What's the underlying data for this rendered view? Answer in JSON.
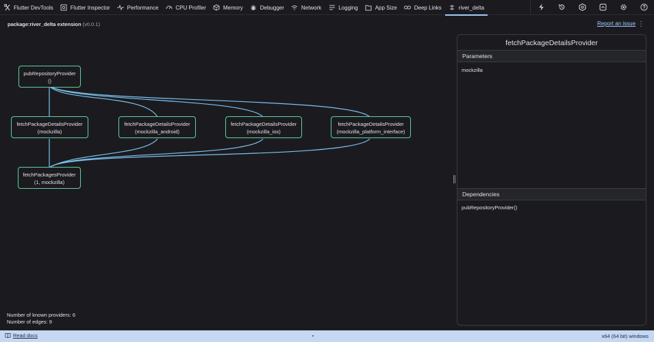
{
  "tabs": [
    {
      "label": "Flutter DevTools",
      "icon": "flutter-devtools-icon"
    },
    {
      "label": "Flutter Inspector",
      "icon": "inspector-icon"
    },
    {
      "label": "Performance",
      "icon": "performance-icon"
    },
    {
      "label": "CPU Profiler",
      "icon": "cpu-profiler-icon"
    },
    {
      "label": "Memory",
      "icon": "memory-icon"
    },
    {
      "label": "Debugger",
      "icon": "debugger-icon"
    },
    {
      "label": "Network",
      "icon": "network-icon"
    },
    {
      "label": "Logging",
      "icon": "logging-icon"
    },
    {
      "label": "App Size",
      "icon": "app-size-icon"
    },
    {
      "label": "Deep Links",
      "icon": "deep-links-icon"
    },
    {
      "label": "river_delta",
      "icon": "extension-icon",
      "active": true
    }
  ],
  "actions": [
    "hot-reload-icon",
    "hot-restart-icon",
    "performance-overlay-icon",
    "export-icon",
    "settings-icon",
    "help-icon"
  ],
  "header": {
    "package": "package:river_delta extension",
    "version": "(v0.0.1)",
    "report_link": "Report an issue"
  },
  "graph": {
    "nodes": [
      {
        "label": "pubRepositoryProvider",
        "args": "()"
      },
      {
        "label": "fetchPackageDetailsProvider",
        "args": "(mockzilla)"
      },
      {
        "label": "fetchPackageDetailsProvider",
        "args": "(mockzilla_android)"
      },
      {
        "label": "fetchPackageDetailsProvider",
        "args": "(mockzilla_ios)"
      },
      {
        "label": "fetchPackageDetailsProvider",
        "args": "(mockzilla_platform_interface)"
      },
      {
        "label": "fetchPackagesProvider",
        "args": "(1, mockzilla)"
      }
    ],
    "colors": {
      "node_border": "#5fd2a0",
      "edge": "#7cc4f2"
    }
  },
  "stats": {
    "providers": "Number of known providers: 6",
    "edges": "Number of edges: 9"
  },
  "panel": {
    "title": "fetchPackageDetailsProvider",
    "parameters_heading": "Parameters",
    "parameters_value": "mockzilla",
    "dependencies_heading": "Dependencies",
    "dependencies_value": "pubRepositoryProvider()"
  },
  "status": {
    "docs_link": "Read docs",
    "platform": "x64 (64 bit) windows"
  }
}
